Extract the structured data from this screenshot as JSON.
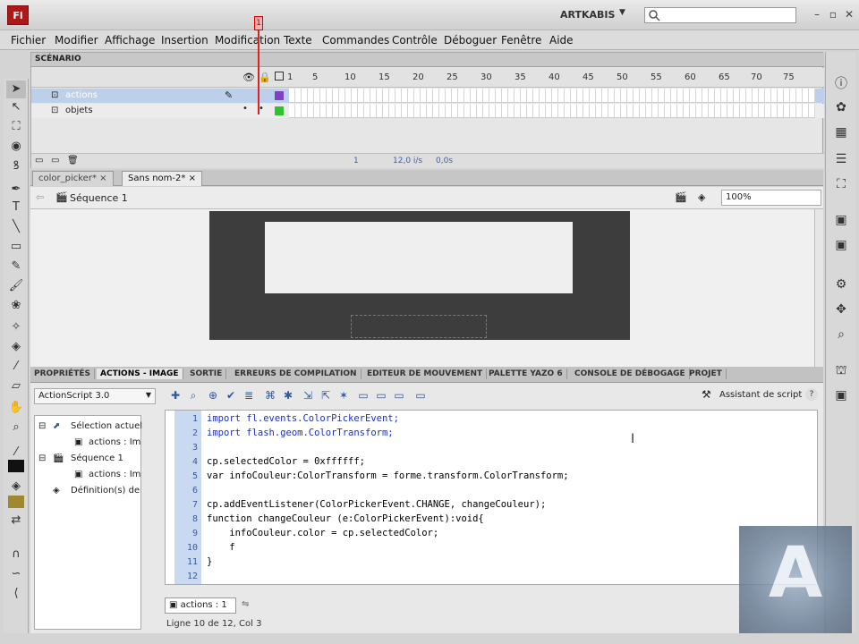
{
  "titlebar": {
    "logo": "Fl",
    "workspace": "ARTKABIS",
    "search_placeholder": ""
  },
  "menubar": [
    "Fichier",
    "Modifier",
    "Affichage",
    "Insertion",
    "Modification",
    "Texte",
    "Commandes",
    "Contrôle",
    "Déboguer",
    "Fenêtre",
    "Aide"
  ],
  "timeline": {
    "tab": "SCÉNARIO",
    "frame_numbers": [
      "1",
      "5",
      "10",
      "15",
      "20",
      "25",
      "30",
      "35",
      "40",
      "45",
      "50",
      "55",
      "60",
      "65",
      "70",
      "75"
    ],
    "layers": [
      {
        "name": "actions"
      },
      {
        "name": "objets"
      }
    ],
    "footer": {
      "frame": "1",
      "fps": "12,0 i/s",
      "time": "0,0s"
    }
  },
  "doc_tabs": [
    {
      "label": "color_picker*",
      "active": false
    },
    {
      "label": "Sans nom-2*",
      "active": true
    }
  ],
  "editbar": {
    "scene": "Séquence 1",
    "zoom": "100%"
  },
  "panel_tabs": [
    {
      "label": "PROPRIÉTÉS",
      "active": false
    },
    {
      "label": "ACTIONS - IMAGE",
      "active": true
    },
    {
      "label": "SORTIE",
      "active": false
    },
    {
      "label": "ERREURS DE COMPILATION",
      "active": false
    },
    {
      "label": "EDITEUR DE MOUVEMENT",
      "active": false
    },
    {
      "label": "PALETTE YAZO 6",
      "active": false
    },
    {
      "label": "CONSOLE DE DÉBOGAGE",
      "active": false
    },
    {
      "label": "PROJET",
      "active": false
    }
  ],
  "actions": {
    "version": "ActionScript 3.0",
    "tree": [
      "Sélection actuell",
      "actions : Im",
      "Séquence 1",
      "actions : Im",
      "Définition(s) de :"
    ],
    "assistant": "Assistant de script",
    "help": "?",
    "code_lines": [
      "import fl.events.ColorPickerEvent;",
      "import flash.geom.ColorTransform;",
      "",
      "cp.selectedColor = 0xffffff;",
      "var infoCouleur:ColorTransform = forme.transform.ColorTransform;",
      "",
      "cp.addEventListener(ColorPickerEvent.CHANGE, changeCouleur);",
      "function changeCouleur (e:ColorPickerEvent):void{",
      "    infoCouleur.color = cp.selectedColor;",
      "    f",
      "}",
      ""
    ],
    "line_numbers": [
      "1",
      "2",
      "3",
      "4",
      "5",
      "6",
      "7",
      "8",
      "9",
      "10",
      "11",
      "12"
    ],
    "code_tab": "actions : 1",
    "status": "Ligne 10 de 12, Col 3"
  },
  "watermark": "A",
  "colors": {
    "accent": "#b01818",
    "keyword": "#1a30c0"
  }
}
